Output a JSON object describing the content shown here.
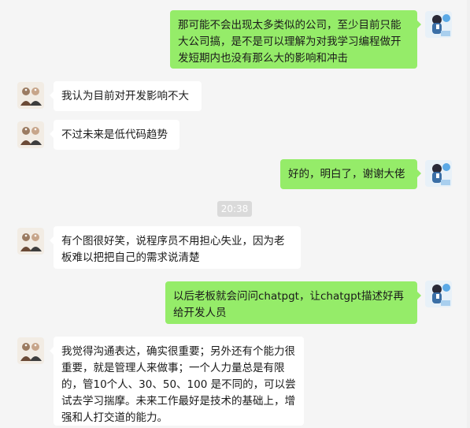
{
  "messages": [
    {
      "side": "out",
      "text": "那可能不会出现太多类似的公司，至少目前只能大公司搞，是不是可以理解为对我学习编程做开发短期内也没有那么大的影响和冲击"
    },
    {
      "side": "in",
      "text": "我认为目前对开发影响不大"
    },
    {
      "side": "in",
      "text": "不过未来是低代码趋势"
    },
    {
      "side": "out",
      "text": "好的，明白了，谢谢大佬"
    },
    {
      "side": "in",
      "text": "有个图很好笑，说程序员不用担心失业，因为老板难以把把自己的需求说清楚"
    },
    {
      "side": "out",
      "text": "以后老板就会问问chatpgt，让chatgpt描述好再给开发人员"
    },
    {
      "side": "in",
      "text": "我觉得沟通表达，确实很重要；另外还有个能力很重要，就是管理人来做事；一个人力量总是有限的，管10个人、30、50、100 是不同的，可以尝试去学习揣摩。未来工作最好是技术的基础上，增强和人打交道的能力。"
    }
  ],
  "timestamp": "20:38",
  "colors": {
    "background": "#f5f5f5",
    "outgoing_bubble": "#95ec69",
    "incoming_bubble": "#ffffff",
    "timestamp_bg": "#dadada"
  },
  "icons": {
    "self_avatar": "user-avatar-icon",
    "contact_avatar": "contact-avatar-icon"
  }
}
